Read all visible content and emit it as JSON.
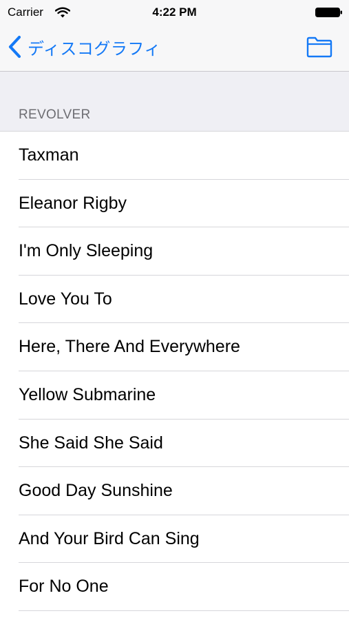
{
  "status_bar": {
    "carrier": "Carrier",
    "time": "4:22 PM"
  },
  "nav": {
    "back_label": "ディスコグラフィ",
    "right_icon": "folder-icon",
    "tint_color": "#1479f6"
  },
  "section": {
    "title": "REVOLVER"
  },
  "songs": [
    "Taxman",
    "Eleanor Rigby",
    "I'm Only Sleeping",
    "Love You To",
    "Here, There And Everywhere",
    "Yellow Submarine",
    "She Said She Said",
    "Good Day Sunshine",
    "And Your Bird Can Sing",
    "For No One"
  ]
}
